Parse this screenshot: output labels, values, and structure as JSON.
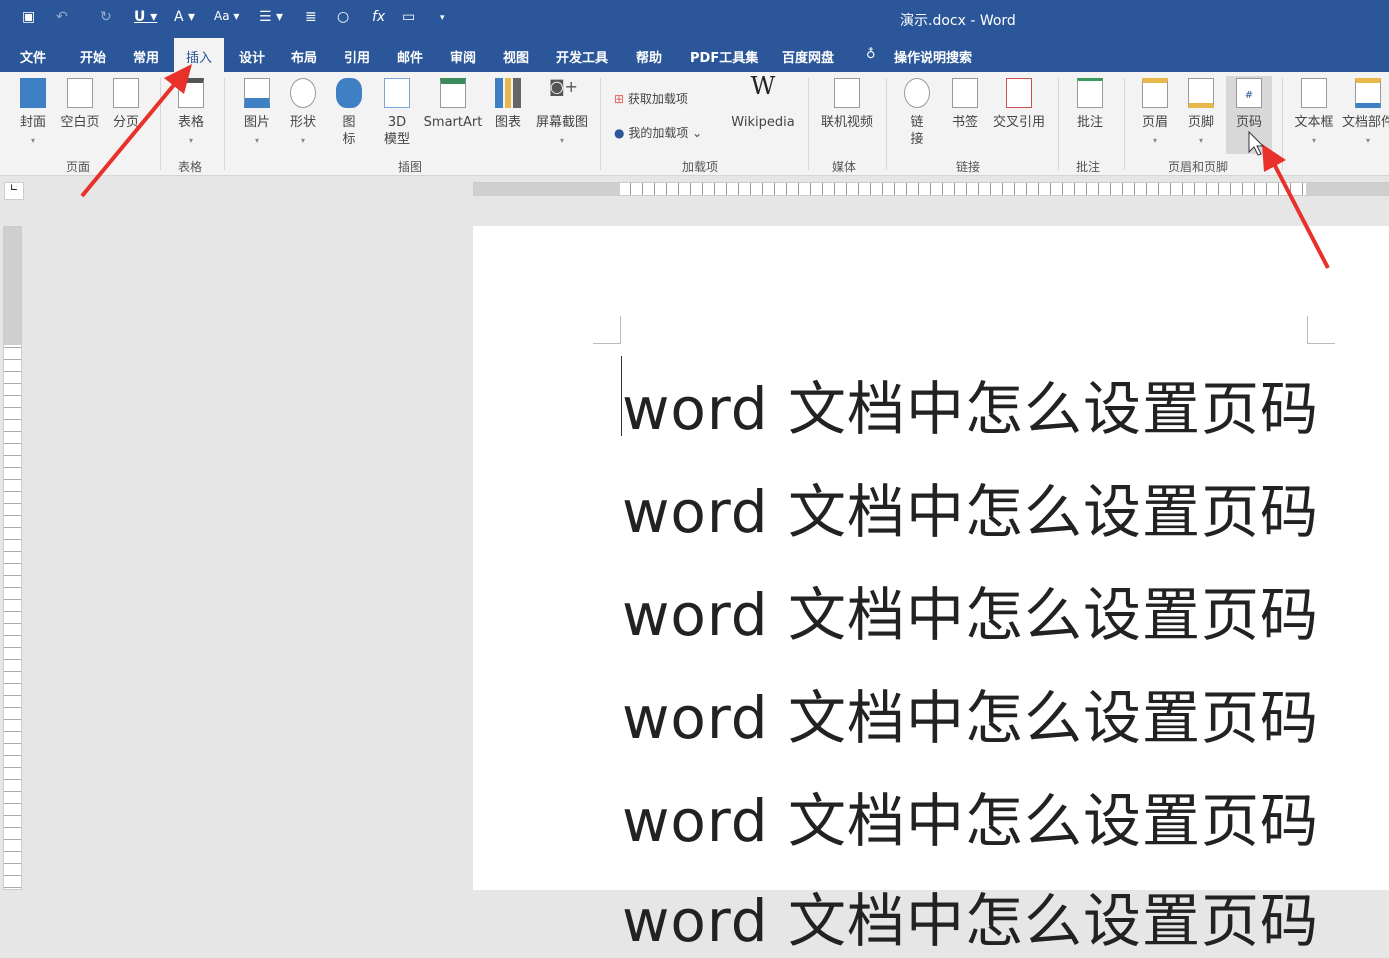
{
  "title": "演示.docx - Word",
  "qat": [
    "save-icon",
    "undo-icon",
    "redo-icon",
    "underline-icon",
    "font-color-icon",
    "change-case-icon",
    "bullets-icon",
    "align-icon",
    "circle-icon",
    "formula-icon",
    "screen-clip-icon",
    "customize-icon"
  ],
  "tabs": [
    "文件",
    "开始",
    "常用",
    "插入",
    "设计",
    "布局",
    "引用",
    "邮件",
    "审阅",
    "视图",
    "开发工具",
    "帮助",
    "PDF工具集",
    "百度网盘",
    "操作说明搜索"
  ],
  "active_tab": "插入",
  "ribbon": {
    "buttons": [
      "封面",
      "空白页",
      "分页",
      "表格",
      "图片",
      "形状",
      "图\n标",
      "3D\n模型",
      "SmartArt",
      "图表",
      "屏幕截图",
      "Wikipedia",
      "联机视频",
      "链\n接",
      "书签",
      "交叉引用",
      "批注",
      "页眉",
      "页脚",
      "页码",
      "文本框",
      "文档部件"
    ],
    "addins": [
      "获取加载项",
      "我的加载项"
    ],
    "groups": [
      "页面",
      "表格",
      "插图",
      "加载项",
      "媒体",
      "链接",
      "批注",
      "页眉和页脚"
    ]
  },
  "document": {
    "lines": [
      "word 文档中怎么设置页码",
      "word 文档中怎么设置页码",
      "word 文档中怎么设置页码",
      "word 文档中怎么设置页码",
      "word 文档中怎么设置页码",
      "word 文档中怎么设置页码"
    ]
  },
  "colors": {
    "brand": "#2b579a",
    "annotation_arrow": "#e8312a"
  }
}
